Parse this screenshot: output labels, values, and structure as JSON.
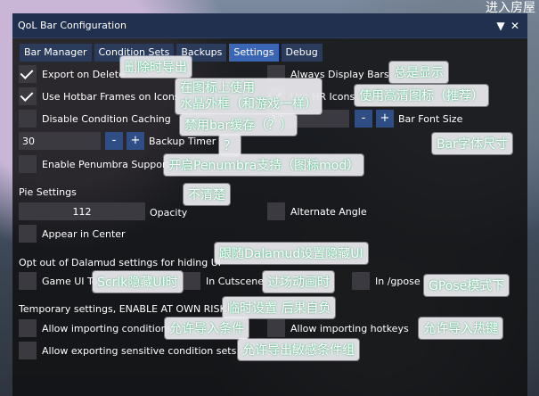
{
  "background": {
    "top_right_text": "进入房屋"
  },
  "window": {
    "title": "QoL Bar Configuration",
    "collapse_icon": "▼",
    "close_icon": "✕"
  },
  "tabs": [
    {
      "label": "Bar Manager",
      "active": false
    },
    {
      "label": "Condition Sets",
      "active": false
    },
    {
      "label": "Backups",
      "active": false
    },
    {
      "label": "Settings",
      "active": true
    },
    {
      "label": "Debug",
      "active": false
    }
  ],
  "settings": {
    "export_on_delete": {
      "label": "Export on Delete",
      "checked": true
    },
    "always_display_bars": {
      "label": "Always Display Bars",
      "checked": false
    },
    "use_hotbar_frames": {
      "label": "Use Hotbar Frames on Icons",
      "checked": true
    },
    "use_hr_icons": {
      "label": "Use HR Icons",
      "checked": true
    },
    "disable_condition_caching": {
      "label": "Disable Condition Caching",
      "checked": false
    },
    "bar_font_size": {
      "value": "17",
      "label": "Bar Font Size"
    },
    "backup_timer": {
      "value": "30",
      "label": "Backup Timer"
    },
    "enable_penumbra": {
      "label": "Enable Penumbra Support",
      "checked": false
    },
    "minus": "-",
    "plus": "+"
  },
  "pie": {
    "heading": "Pie Settings",
    "opacity_value": "112",
    "opacity_label": "Opacity",
    "alternate_angle": {
      "label": "Alternate Angle",
      "checked": false
    },
    "appear_in_center": {
      "label": "Appear in Center",
      "checked": false
    }
  },
  "dalamud": {
    "heading": "Opt out of Dalamud settings for hiding UI",
    "game_ui": {
      "label": "Game UI To",
      "checked": false
    },
    "in_cutscene": {
      "label": "In Cutscene",
      "checked": false
    },
    "in_gpose": {
      "label": "In /gpose",
      "checked": false
    }
  },
  "temporary": {
    "heading": "Temporary settings, ENABLE AT OWN RISK",
    "allow_importing_conditions": {
      "label": "Allow importing conditions",
      "checked": false
    },
    "allow_importing_hotkeys": {
      "label": "Allow importing hotkeys",
      "checked": false
    },
    "allow_exporting_sensitive": {
      "label": "Allow exporting sensitive condition sets",
      "checked": false
    }
  },
  "annotations": {
    "export_delete": "删除时导出",
    "always_display": "总是显示",
    "hotbar_frames_1": "在图标上使用",
    "hotbar_frames_2": "水晶外框（和游戏一样）",
    "hr_icons": "使用高清图标（推荐）",
    "disable_cache": "禁用bar缓存（？）",
    "backup_q": "？",
    "font_size": "Bar字体尺寸",
    "penumbra": "开启Penumbra支持（图标mod）",
    "pie_unclear": "不清楚",
    "follow_dalamud": "跟随Dalamud设置隐藏UI",
    "scrlk": "Scrlk隐藏UI时",
    "cutscene": "过场动画时",
    "gpose": "GPose模式下",
    "temporary": "临时设置 后果自负",
    "allow_import_cond": "允许导入条件",
    "allow_import_hotkeys": "允许导入热键",
    "allow_export_sensitive": "允许导出敏感条件组"
  }
}
